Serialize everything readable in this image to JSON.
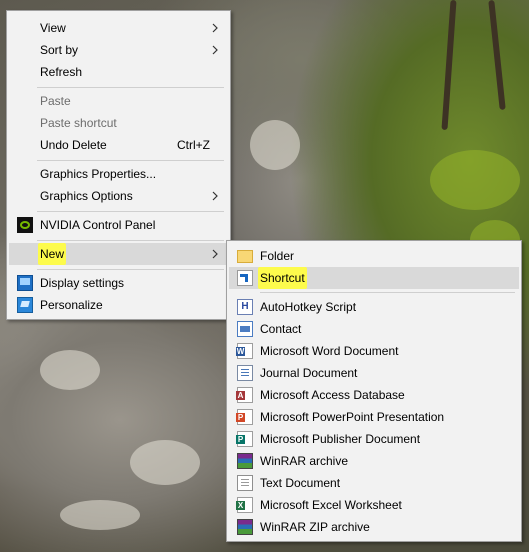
{
  "context_menu": {
    "items": [
      {
        "label": "View",
        "has_submenu": true
      },
      {
        "label": "Sort by",
        "has_submenu": true
      },
      {
        "label": "Refresh"
      },
      {
        "label": "Paste",
        "disabled": true
      },
      {
        "label": "Paste shortcut",
        "disabled": true
      },
      {
        "label": "Undo Delete",
        "shortcut": "Ctrl+Z"
      },
      {
        "label": "Graphics Properties..."
      },
      {
        "label": "Graphics Options",
        "has_submenu": true
      },
      {
        "label": "NVIDIA Control Panel",
        "icon": "nvidia-icon"
      },
      {
        "label": "New",
        "has_submenu": true,
        "highlighted": true
      },
      {
        "label": "Display settings",
        "icon": "display-settings-icon"
      },
      {
        "label": "Personalize",
        "icon": "personalize-icon"
      }
    ]
  },
  "new_submenu": {
    "items": [
      {
        "label": "Folder",
        "icon": "folder-icon"
      },
      {
        "label": "Shortcut",
        "icon": "shortcut-icon",
        "highlighted": true
      },
      {
        "label": "AutoHotkey Script",
        "icon": "autohotkey-icon"
      },
      {
        "label": "Contact",
        "icon": "contact-icon"
      },
      {
        "label": "Microsoft Word Document",
        "icon": "word-icon"
      },
      {
        "label": "Journal Document",
        "icon": "journal-icon"
      },
      {
        "label": "Microsoft Access Database",
        "icon": "access-icon"
      },
      {
        "label": "Microsoft PowerPoint Presentation",
        "icon": "powerpoint-icon"
      },
      {
        "label": "Microsoft Publisher Document",
        "icon": "publisher-icon"
      },
      {
        "label": "WinRAR archive",
        "icon": "winrar-icon"
      },
      {
        "label": "Text Document",
        "icon": "text-document-icon"
      },
      {
        "label": "Microsoft Excel Worksheet",
        "icon": "excel-icon"
      },
      {
        "label": "WinRAR ZIP archive",
        "icon": "winrar-zip-icon"
      }
    ]
  },
  "colors": {
    "menu_background": "#f2f2f2",
    "hover_highlight": "#d9d9d9",
    "annotation_highlight": "#fdfb4c"
  }
}
